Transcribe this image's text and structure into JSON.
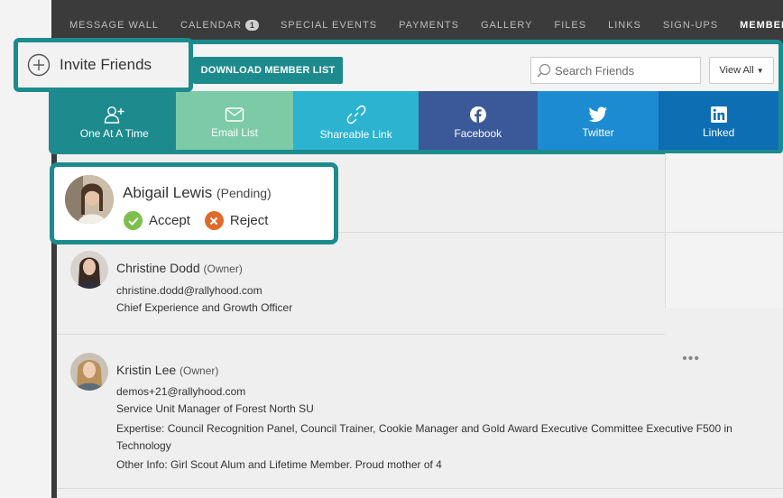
{
  "nav": {
    "items": [
      {
        "label": "MESSAGE WALL"
      },
      {
        "label": "CALENDAR",
        "badge": "1"
      },
      {
        "label": "SPECIAL EVENTS"
      },
      {
        "label": "PAYMENTS"
      },
      {
        "label": "GALLERY"
      },
      {
        "label": "FILES"
      },
      {
        "label": "LINKS"
      },
      {
        "label": "SIGN-UPS"
      },
      {
        "label": "MEMBERS",
        "active": true
      }
    ]
  },
  "invite": {
    "label": "Invite Friends",
    "icon": "plus-circle-icon"
  },
  "toolbar": {
    "download_label": "DOWNLOAD MEMBER LIST",
    "search_placeholder": "Search Friends",
    "view_all_label": "View All"
  },
  "invite_tiles": [
    {
      "label": "One At A Time",
      "icon": "add-person-icon",
      "color": "#1d8b8d"
    },
    {
      "label": "Email List",
      "icon": "envelope-icon",
      "color": "#7ccaa6"
    },
    {
      "label": "Shareable Link",
      "icon": "link-icon",
      "color": "#2bb3cf"
    },
    {
      "label": "Facebook",
      "icon": "facebook-icon",
      "color": "#3b5998"
    },
    {
      "label": "Twitter",
      "icon": "twitter-icon",
      "color": "#1d8bd2"
    },
    {
      "label": "Linked",
      "icon": "linkedin-icon",
      "color": "#0e6eb4"
    }
  ],
  "pending": {
    "name": "Abigail Lewis",
    "status": "(Pending)",
    "accept_label": "Accept",
    "reject_label": "Reject"
  },
  "members": [
    {
      "name": "Christine Dodd",
      "role": "(Owner)",
      "lines": [
        "christine.dodd@rallyhood.com",
        "Chief Experience and Growth Officer"
      ]
    },
    {
      "name": "Kristin Lee",
      "role": "(Owner)",
      "lines": [
        "demos+21@rallyhood.com",
        "Service Unit Manager of Forest North SU",
        "Expertise: Council Recognition Panel, Council Trainer, Cookie Manager and Gold Award Executive Committee Executive F500 in",
        "Technology",
        "Other Info: Girl Scout Alum and Lifetime Member. Proud mother of 4"
      ],
      "more_label": "•••"
    }
  ],
  "colors": {
    "accent": "#1d8b8d",
    "accept": "#7cc04b",
    "reject": "#e06a2b",
    "nav_bg": "#3b3b3b"
  }
}
